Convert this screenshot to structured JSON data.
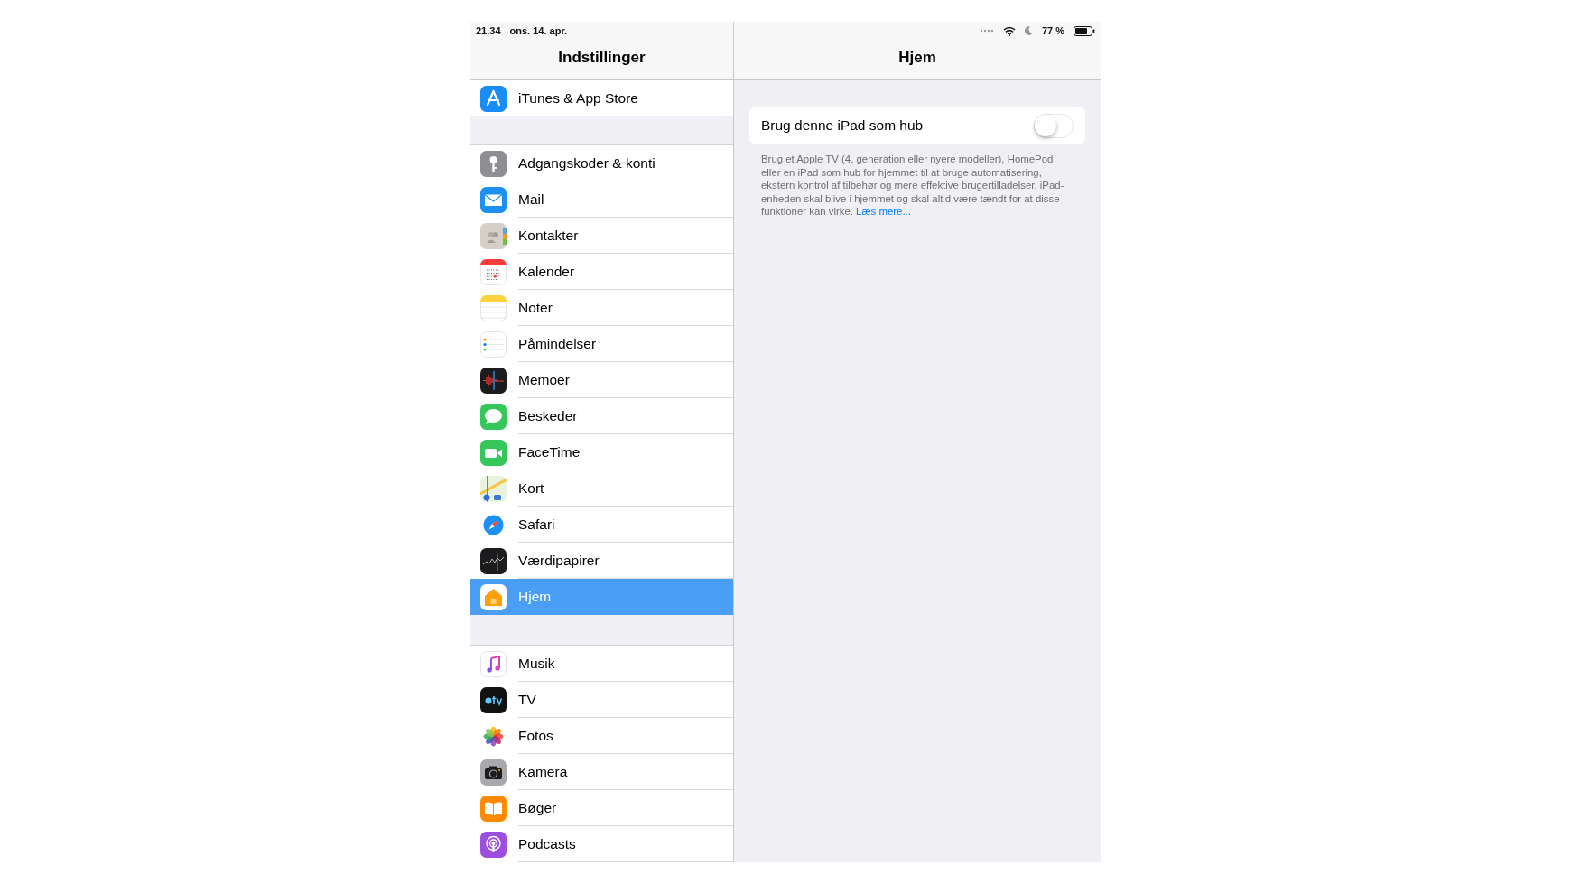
{
  "status_bar": {
    "time": "21.34",
    "date": "ons. 14. apr.",
    "battery": "77 %"
  },
  "sidebar": {
    "title": "Indstillinger",
    "groups": [
      [
        {
          "label": "iTunes & App Store",
          "selected": false
        }
      ],
      [
        {
          "label": "Adgangskoder & konti",
          "selected": false
        },
        {
          "label": "Mail",
          "selected": false
        },
        {
          "label": "Kontakter",
          "selected": false
        },
        {
          "label": "Kalender",
          "selected": false
        },
        {
          "label": "Noter",
          "selected": false
        },
        {
          "label": "Påmindelser",
          "selected": false
        },
        {
          "label": "Memoer",
          "selected": false
        },
        {
          "label": "Beskeder",
          "selected": false
        },
        {
          "label": "FaceTime",
          "selected": false
        },
        {
          "label": "Kort",
          "selected": false
        },
        {
          "label": "Safari",
          "selected": false
        },
        {
          "label": "Værdipapirer",
          "selected": false
        },
        {
          "label": "Hjem",
          "selected": true
        }
      ],
      [
        {
          "label": "Musik",
          "selected": false
        },
        {
          "label": "TV",
          "selected": false
        },
        {
          "label": "Fotos",
          "selected": false
        },
        {
          "label": "Kamera",
          "selected": false
        },
        {
          "label": "Bøger",
          "selected": false
        },
        {
          "label": "Podcasts",
          "selected": false
        }
      ]
    ]
  },
  "detail": {
    "title": "Hjem",
    "setting": {
      "label": "Brug denne iPad som hub",
      "on": false
    },
    "footer": "Brug et Apple TV (4. generation eller nyere modeller), HomePod eller en iPad som hub for hjemmet til at bruge automatisering, ekstern kontrol af tilbehør og mere effektive brugertilladelser. iPad-enheden skal blive i hjemmet og skal altid være tændt for at disse funktioner kan virke.",
    "link": "Læs mere..."
  }
}
